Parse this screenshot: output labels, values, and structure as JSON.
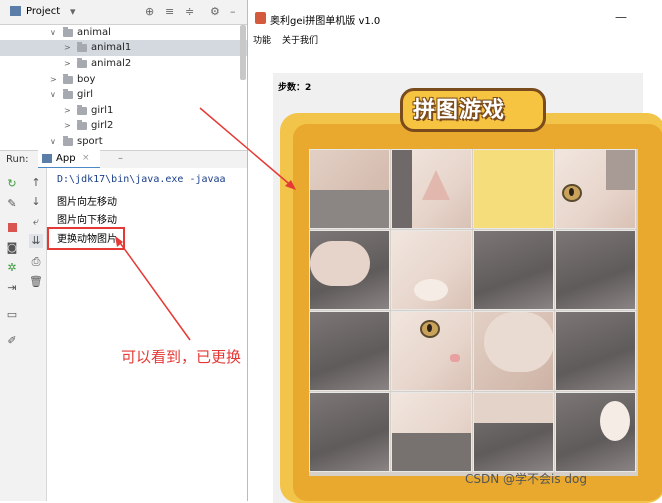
{
  "ide": {
    "project_title": "Project",
    "tree": [
      {
        "label": "animal",
        "expanded": true,
        "indent": 0
      },
      {
        "label": "animal1",
        "expanded": false,
        "indent": 1,
        "selected": true
      },
      {
        "label": "animal2",
        "expanded": false,
        "indent": 1
      },
      {
        "label": "boy",
        "expanded": false,
        "indent": 0
      },
      {
        "label": "girl",
        "expanded": true,
        "indent": 0
      },
      {
        "label": "girl1",
        "expanded": false,
        "indent": 1
      },
      {
        "label": "girl2",
        "expanded": false,
        "indent": 1
      },
      {
        "label": "sport",
        "expanded": true,
        "indent": 0
      }
    ],
    "run_label": "Run:",
    "run_tab": "App",
    "console": [
      "D:\\jdk17\\bin\\java.exe -javaa",
      "图片向左移动",
      "图片向下移动",
      "更换动物图片"
    ]
  },
  "annotation": {
    "text": "可以看到，已更换",
    "color": "#e53935"
  },
  "game_window": {
    "title": "奥利gei拼图单机版 v1.0",
    "menu": [
      "功能",
      "关于我们"
    ],
    "steps_label": "步数：2",
    "game_title": "拼图游戏"
  },
  "watermark": "CSDN @学不会is dog",
  "colors": {
    "frame": "#f3c44a",
    "empty_tile": "#f6dd7b",
    "accent": "#4a88c7"
  }
}
